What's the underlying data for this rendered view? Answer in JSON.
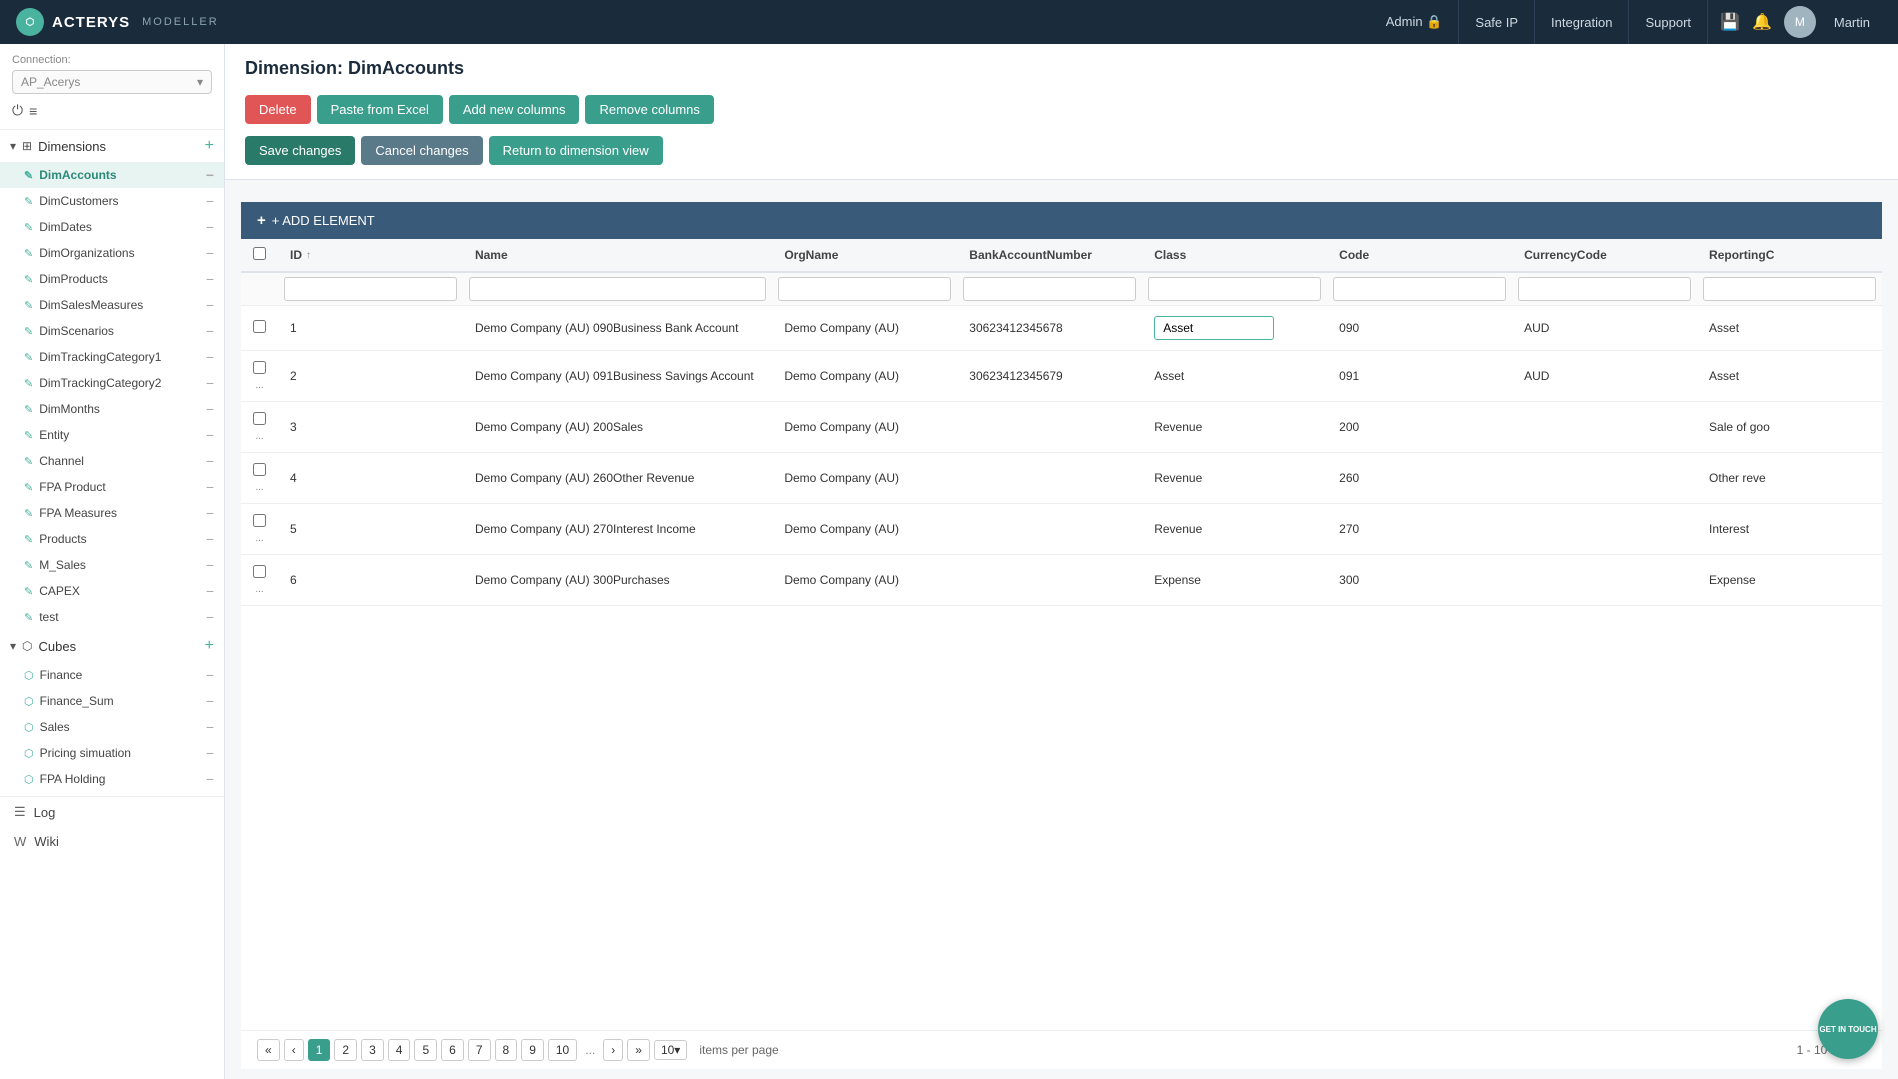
{
  "topnav": {
    "logo_text": "ACTERYS",
    "modeller_text": "MODELLER",
    "links": [
      {
        "label": "Admin",
        "icon": "🔒"
      },
      {
        "label": "Safe IP"
      },
      {
        "label": "Integration"
      },
      {
        "label": "Support"
      }
    ],
    "username": "Martin"
  },
  "sidebar": {
    "connection_label": "Connection:",
    "connection_value": "AP_Acerys",
    "dimensions_label": "Dimensions",
    "dimensions_items": [
      {
        "label": "DimAccounts",
        "active": true
      },
      {
        "label": "DimCustomers"
      },
      {
        "label": "DimDates"
      },
      {
        "label": "DimOrganizations"
      },
      {
        "label": "DimProducts"
      },
      {
        "label": "DimSalesMeasures"
      },
      {
        "label": "DimScenarios"
      },
      {
        "label": "DimTrackingCategory1"
      },
      {
        "label": "DimTrackingCategory2"
      },
      {
        "label": "DimMonths"
      },
      {
        "label": "Entity"
      },
      {
        "label": "Channel"
      },
      {
        "label": "FPA Product"
      },
      {
        "label": "FPA Measures"
      },
      {
        "label": "Products"
      },
      {
        "label": "M_Sales"
      },
      {
        "label": "CAPEX"
      },
      {
        "label": "test"
      }
    ],
    "cubes_label": "Cubes",
    "cubes_items": [
      {
        "label": "Finance"
      },
      {
        "label": "Finance_Sum"
      },
      {
        "label": "Sales"
      },
      {
        "label": "Pricing simuation"
      },
      {
        "label": "FPA Holding"
      }
    ],
    "bottom_items": [
      {
        "label": "Log",
        "icon": "☰"
      },
      {
        "label": "Wiki",
        "icon": "W"
      }
    ]
  },
  "content": {
    "page_title": "Dimension: DimAccounts",
    "toolbar_top": {
      "delete_label": "Delete",
      "paste_excel_label": "Paste from Excel",
      "add_columns_label": "Add new columns",
      "remove_columns_label": "Remove columns"
    },
    "toolbar_bottom": {
      "save_label": "Save changes",
      "cancel_label": "Cancel changes",
      "return_label": "Return to dimension view"
    },
    "add_element_label": "+ ADD ELEMENT",
    "table": {
      "columns": [
        "ID",
        "Name",
        "OrgName",
        "BankAccountNumber",
        "Class",
        "Code",
        "CurrencyCode",
        "ReportingC"
      ],
      "rows": [
        {
          "id": "1",
          "name": "Demo Company (AU) 090Business Bank Account",
          "orgname": "Demo Company (AU)",
          "bank": "30623412345678",
          "class": "Asset",
          "code": "090",
          "currency": "AUD",
          "reporting": "Asset",
          "class_editing": true
        },
        {
          "id": "2",
          "name": "Demo Company (AU) 091Business Savings Account",
          "orgname": "Demo Company (AU)",
          "bank": "30623412345679",
          "class": "Asset",
          "code": "091",
          "currency": "AUD",
          "reporting": "Asset"
        },
        {
          "id": "3",
          "name": "Demo Company (AU) 200Sales",
          "orgname": "Demo Company (AU)",
          "bank": "",
          "class": "Revenue",
          "code": "200",
          "currency": "",
          "reporting": "Sale of goo"
        },
        {
          "id": "4",
          "name": "Demo Company (AU) 260Other Revenue",
          "orgname": "Demo Company (AU)",
          "bank": "",
          "class": "Revenue",
          "code": "260",
          "currency": "",
          "reporting": "Other reve"
        },
        {
          "id": "5",
          "name": "Demo Company (AU) 270Interest Income",
          "orgname": "Demo Company (AU)",
          "bank": "",
          "class": "Revenue",
          "code": "270",
          "currency": "",
          "reporting": "Interest"
        },
        {
          "id": "6",
          "name": "Demo Company (AU) 300Purchases",
          "orgname": "Demo Company (AU)",
          "bank": "",
          "class": "Expense",
          "code": "300",
          "currency": "",
          "reporting": "Expense"
        }
      ]
    },
    "pagination": {
      "pages": [
        "1",
        "2",
        "3",
        "4",
        "5",
        "6",
        "7",
        "8",
        "9",
        "10"
      ],
      "dots": "...",
      "per_page": "10",
      "items_per_page_label": "items per page",
      "total_label": "1 - 10 / items"
    }
  },
  "get_in_touch": "GET IN TOUCH"
}
